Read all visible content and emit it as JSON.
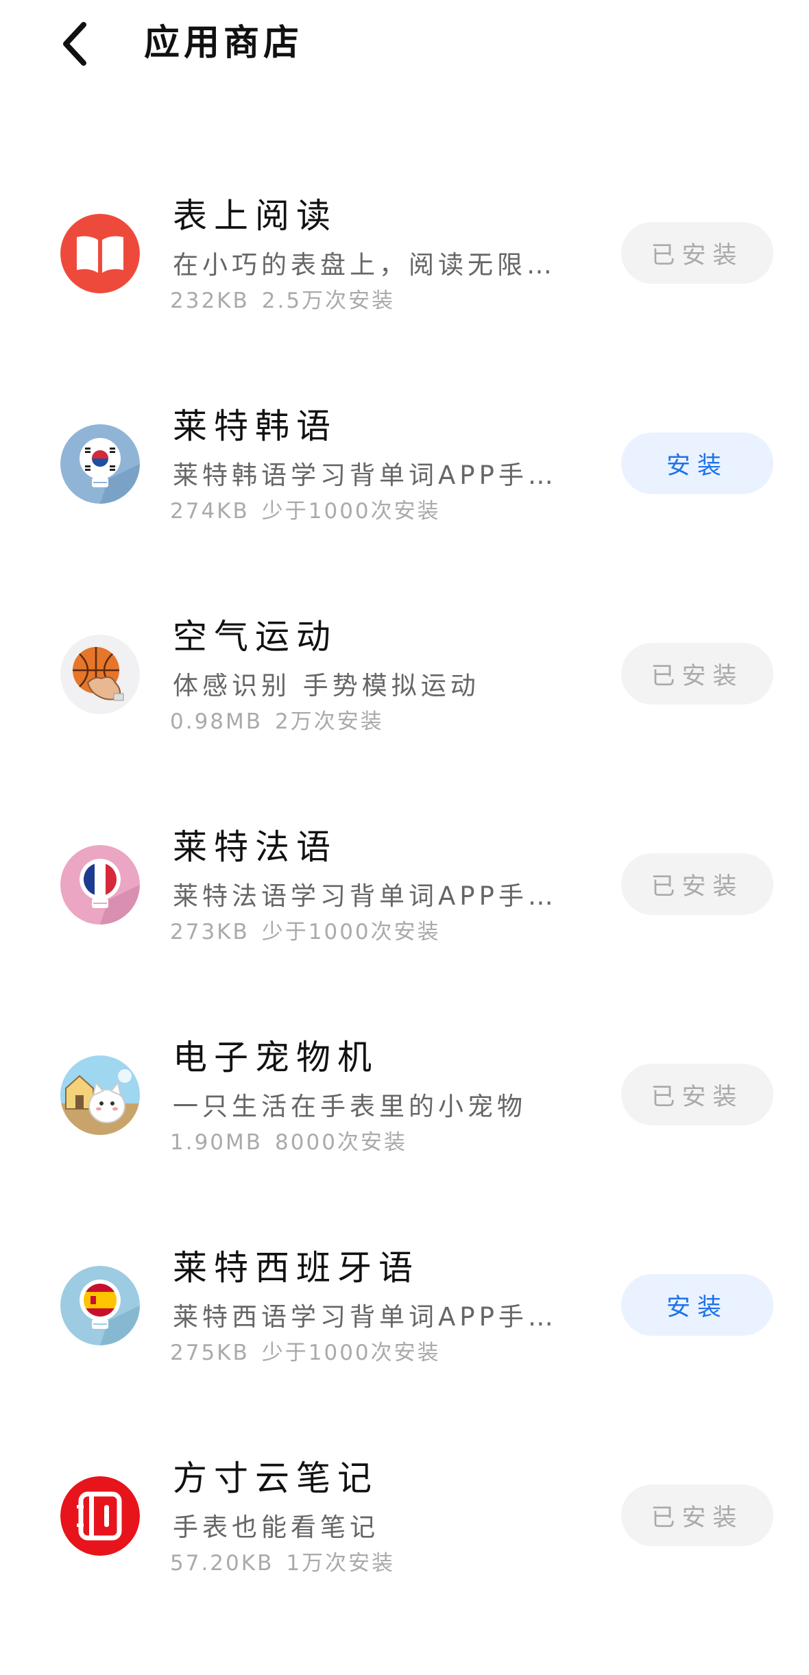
{
  "header": {
    "title": "应用商店"
  },
  "apps": [
    {
      "name": "表上阅读",
      "desc": "在小巧的表盘上，阅读无限…",
      "size": "232KB",
      "installs": "2.5万次安装",
      "button": "已安装",
      "installed": true,
      "icon": "book-icon"
    },
    {
      "name": "莱特韩语",
      "desc": "莱特韩语学习背单词APP手…",
      "size": "274KB",
      "installs": "少于1000次安装",
      "button": "安装",
      "installed": false,
      "icon": "korea-flag-bulb-icon"
    },
    {
      "name": "空气运动",
      "desc": "体感识别 手势模拟运动",
      "size": "0.98MB",
      "installs": "2万次安装",
      "button": "已安装",
      "installed": true,
      "icon": "basketball-hand-icon"
    },
    {
      "name": "莱特法语",
      "desc": "莱特法语学习背单词APP手…",
      "size": "273KB",
      "installs": "少于1000次安装",
      "button": "已安装",
      "installed": true,
      "icon": "france-flag-bulb-icon"
    },
    {
      "name": "电子宠物机",
      "desc": "一只生活在手表里的小宠物",
      "size": "1.90MB",
      "installs": "8000次安装",
      "button": "已安装",
      "installed": true,
      "icon": "pet-cat-icon"
    },
    {
      "name": "莱特西班牙语",
      "desc": "莱特西语学习背单词APP手…",
      "size": "275KB",
      "installs": "少于1000次安装",
      "button": "安装",
      "installed": false,
      "icon": "spain-flag-bulb-icon"
    },
    {
      "name": "方寸云笔记",
      "desc": "手表也能看笔记",
      "size": "57.20KB",
      "installs": "1万次安装",
      "button": "已安装",
      "installed": true,
      "icon": "notebook-icon"
    }
  ],
  "colors": {
    "accent": "#1e72e8",
    "install_bg": "#eaf2ff",
    "installed_bg": "#f3f3f3"
  }
}
